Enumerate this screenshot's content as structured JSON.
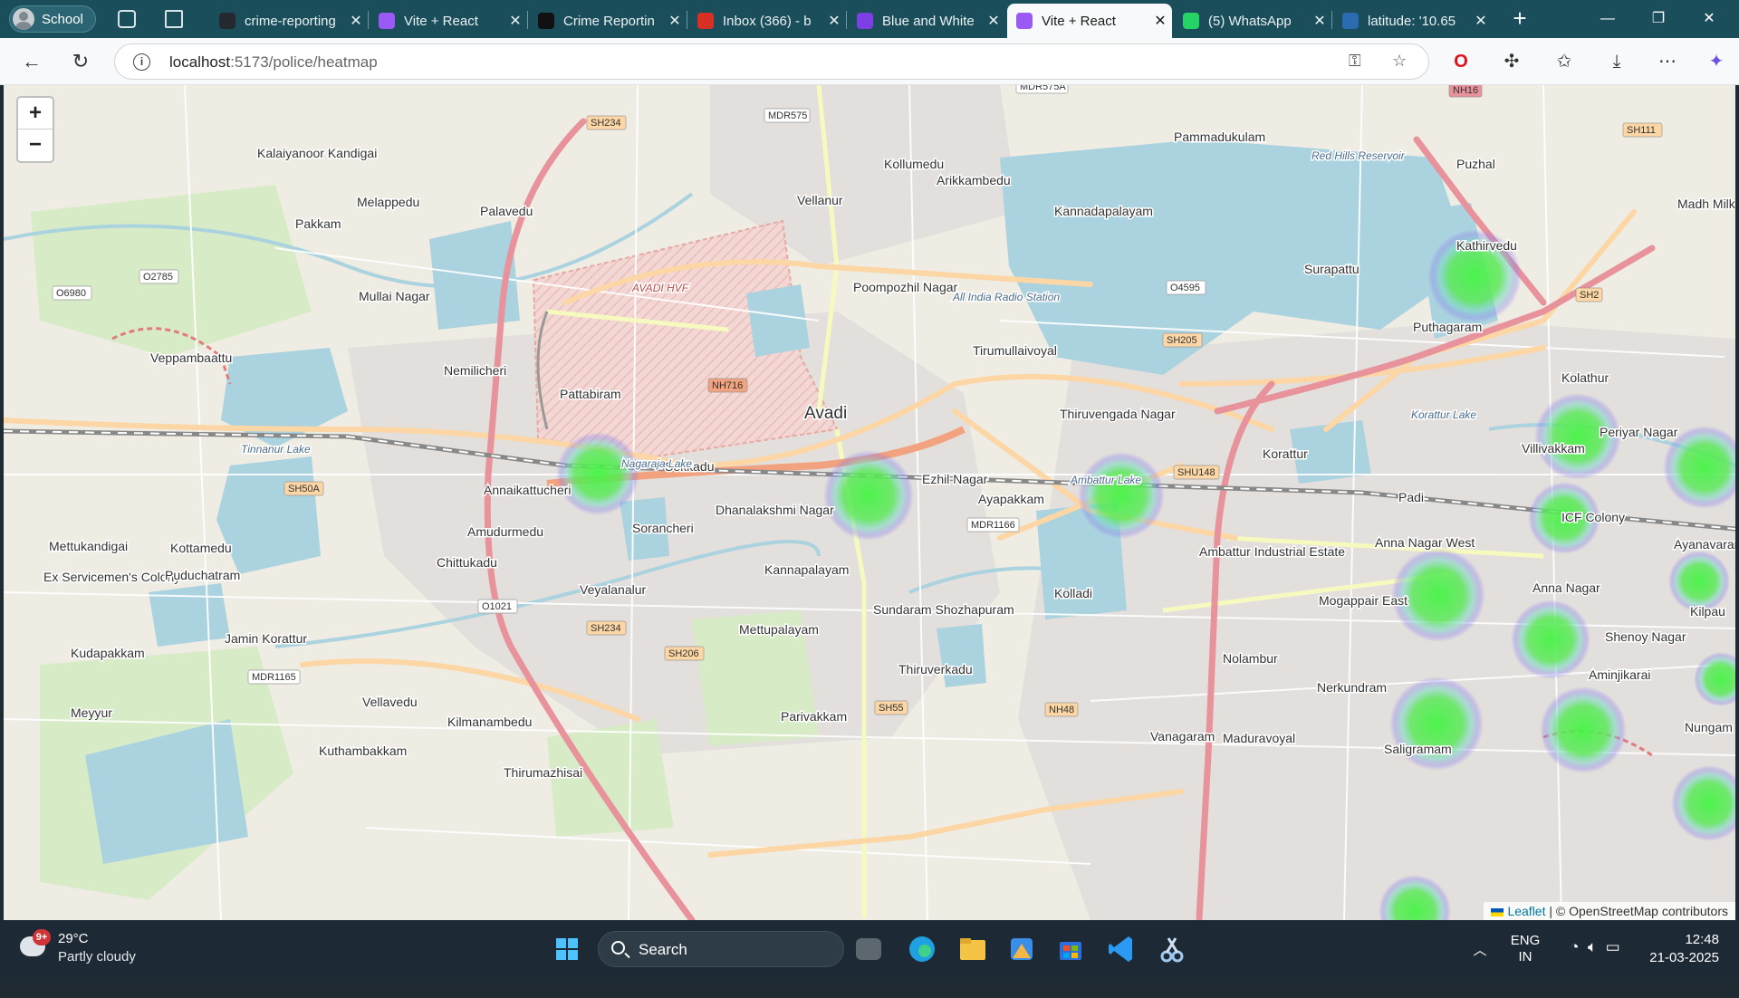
{
  "browser": {
    "profile": "School",
    "tabs": [
      {
        "title": "crime-reporting",
        "icon": "github-icon",
        "color": "#24292f"
      },
      {
        "title": "Vite + React",
        "icon": "vite-icon",
        "color": "#9b59f6"
      },
      {
        "title": "Crime Reportin",
        "icon": "openai-icon",
        "color": "#111111"
      },
      {
        "title": "Inbox (366) - b",
        "icon": "gmail-icon",
        "color": "#d93025"
      },
      {
        "title": "Blue and White",
        "icon": "canva-icon",
        "color": "#7b3fe4"
      },
      {
        "title": "Vite + React",
        "icon": "vite-icon",
        "color": "#9b59f6",
        "active": true
      },
      {
        "title": "(5) WhatsApp",
        "icon": "whatsapp-icon",
        "color": "#25d366"
      },
      {
        "title": "latitude: '10.65",
        "icon": "search-icon",
        "color": "#2b6cb0"
      }
    ],
    "url_host": "localhost",
    "url_path": ":5173/police/heatmap"
  },
  "map": {
    "zoom_in": "+",
    "zoom_out": "−",
    "attribution_leaflet": "Leaflet",
    "attribution_rest": " | © OpenStreetMap contributors",
    "road_shields": [
      "SH234",
      "MDR575",
      "MDR575A",
      "NH16",
      "SH111",
      "O2785",
      "O6980",
      "NH716",
      "O4595",
      "SH205",
      "SH2",
      "SHU148",
      "SH50A",
      "MDR1166",
      "O1021",
      "SH234",
      "SH206",
      "MDR1165",
      "SH55",
      "NH48"
    ],
    "places": [
      "Kalaiyanoor Kandigai",
      "Melappedu",
      "Pakkam",
      "Palavedu",
      "Vellanur",
      "Kollumedu",
      "Arikkambedu",
      "Pammadukulam",
      "Kannadapalayam",
      "Red Hills Reservoir",
      "Puzhal",
      "Kathirvedu",
      "Surapattu",
      "Madh Milk",
      "Mullai Nagar",
      "AVADI HVF",
      "Poompozhil Nagar",
      "All India Radio Station",
      "Puthagaram",
      "Veppambaattu",
      "Nemilicheri",
      "Tirumullaivoyal",
      "Kolathur",
      "Pattabiram",
      "Avadi",
      "Thiruvengada Nagar",
      "Periyar Nagar",
      "Villivakkam",
      "Tinnanur Lake",
      "Sekkadu",
      "Nagaraja Lake",
      "Korattur Lake",
      "Korattur",
      "Annaikattucheri",
      "Ezhil Nagar",
      "Ayapakkam",
      "Ambattur Lake",
      "Padi",
      "Dhanalakshmi Nagar",
      "ICF Colony",
      "Ayanavaram",
      "Amudurmedu",
      "Sorancheri",
      "Anna Nagar West",
      "Ambattur Industrial Estate",
      "Mettukandigai",
      "Kottamedu",
      "Chittukadu",
      "Kannapalayam",
      "Anna Nagar",
      "Ex Servicemen's Colony",
      "Puduchatram",
      "Veyalanalur",
      "Mogappair East",
      "Kolladi",
      "Sundaram Shozhapuram",
      "Mettupalayam",
      "Kilpau",
      "Shenoy Nagar",
      "Jamin Korattur",
      "Kudapakkam",
      "Nolambur",
      "Aminjikarai",
      "Thiruverkadu",
      "Nerkundram",
      "Meyyur",
      "Vellavedu",
      "Kilmanambedu",
      "Parivakkam",
      "Nungam",
      "Vanagaram",
      "Maduravoyal",
      "Saligramam",
      "Kuthambakkam",
      "Thirumazhisai"
    ],
    "heat_color": "#3cf03c",
    "heat_halo": "#8a7cf0"
  },
  "taskbar": {
    "weather_temp": "29°C",
    "weather_desc": "Partly cloudy",
    "weather_badge": "9+",
    "search": "Search",
    "lang": "ENG",
    "lang_region": "IN",
    "time": "12:48",
    "date": "21-03-2025"
  }
}
